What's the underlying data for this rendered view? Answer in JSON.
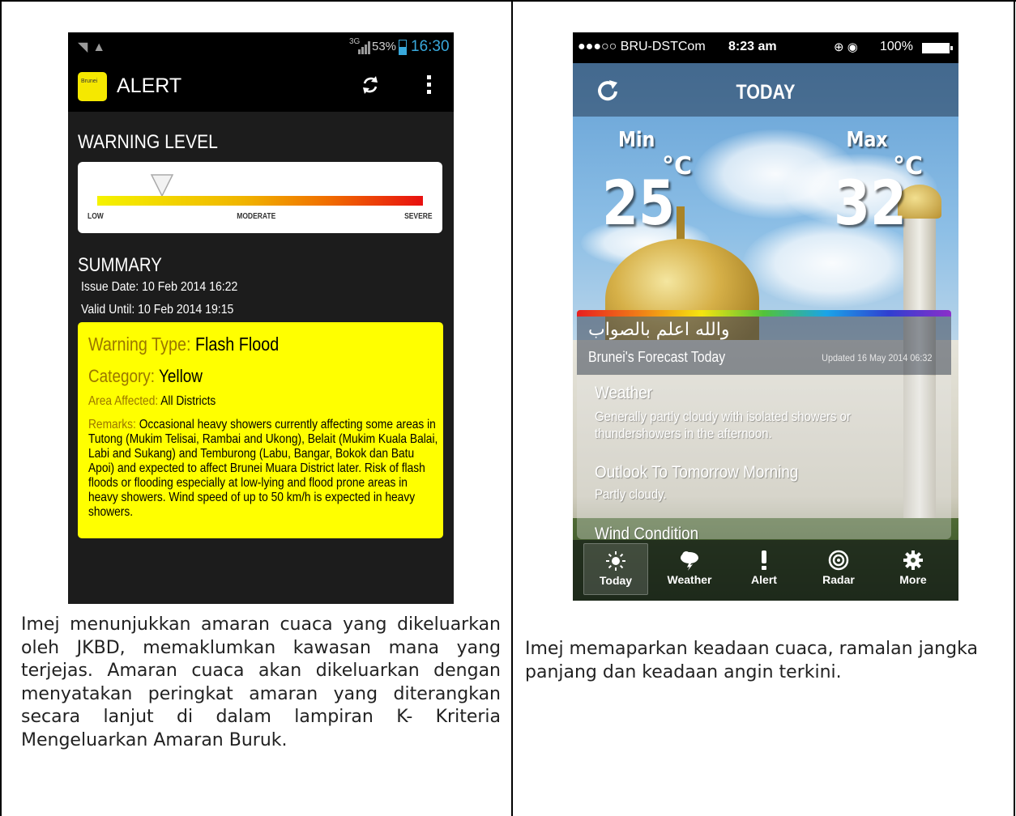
{
  "left_phone": {
    "status": {
      "network": "3G",
      "battery_pct": "53%",
      "time": "16:30",
      "accent": "#39a9dc"
    },
    "appbar": {
      "logo_text": "Brunei",
      "title": "ALERT",
      "refresh_icon": "refresh-icon",
      "overflow_icon": "more-vertical-icon"
    },
    "warning": {
      "heading": "WARNING LEVEL",
      "levels": [
        "LOW",
        "MODERATE",
        "SEVERE"
      ],
      "indicator_level": 0.2
    },
    "summary": {
      "heading": "SUMMARY",
      "issue_date": "Issue Date: 10 Feb 2014 16:22",
      "valid_until": "Valid Until: 10 Feb 2014 19:15",
      "warning_type_label": "Warning Type:",
      "warning_type_value": "Flash Flood",
      "category_label": "Category:",
      "category_value": "Yellow",
      "area_label": "Area Affected:",
      "area_value": "All Districts",
      "remarks_label": "Remarks:",
      "remarks_value": "Occasional heavy showers currently affecting some areas in Tutong (Mukim Telisai, Rambai and Ukong), Belait (Mukim Kuala Balai, Labi and Sukang) and Temburong (Labu, Bangar, Bokok dan Batu Apoi) and expected to affect Brunei Muara District later. Risk of flash floods or flooding especially at low-lying and flood prone areas in heavy showers. Wind speed of up to 50 km/h is expected in heavy showers.",
      "card_color": "#ffff00"
    },
    "caption": "Imej menunjukkan amaran cuaca yang dikeluarkan oleh JKBD, memaklumkan kawasan mana yang terjejas. Amaran cuaca akan dikeluarkan dengan menyatakan peringkat amaran yang diterangkan secara lanjut di dalam lampiran K- Kriteria Mengeluarkan Amaran Buruk."
  },
  "right_phone": {
    "status": {
      "carrier": "●●●○○ BRU-DSTCom",
      "time": "8:23 am",
      "battery_pct": "100%"
    },
    "nav": {
      "title": "TODAY",
      "refresh_icon": "refresh-icon"
    },
    "temps": {
      "min_label": "Min",
      "min_value": "25",
      "max_label": "Max",
      "max_value": "32",
      "unit": "°C"
    },
    "forecast": {
      "arabic": "والله اعلم بالصواب",
      "title": "Brunei's Forecast Today",
      "updated": "Updated 16 May 2014 06:32"
    },
    "details": [
      {
        "heading": "Weather",
        "text": "Generally partly cloudy with isolated showers or thundershowers in the afternoon."
      },
      {
        "heading": "Outlook To Tomorrow Morning",
        "text": "Partly cloudy."
      },
      {
        "heading": "Wind Condition",
        "text": ""
      }
    ],
    "tabs": [
      {
        "label": "Today",
        "icon": "sun-icon",
        "active": true
      },
      {
        "label": "Weather",
        "icon": "cloud-rain-icon",
        "active": false
      },
      {
        "label": "Alert",
        "icon": "exclamation-icon",
        "active": false
      },
      {
        "label": "Radar",
        "icon": "radar-icon",
        "active": false
      },
      {
        "label": "More",
        "icon": "gear-icon",
        "active": false
      }
    ],
    "caption": "Imej memaparkan keadaan cuaca, ramalan jangka panjang dan keadaan angin terkini."
  }
}
